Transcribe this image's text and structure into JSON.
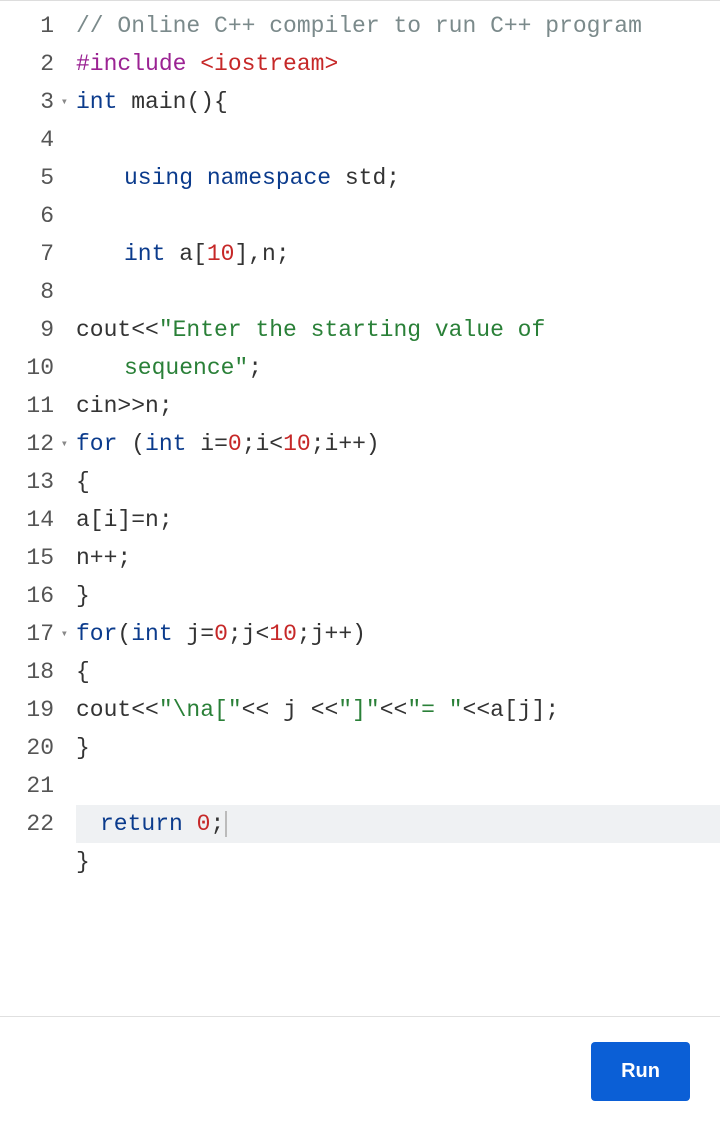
{
  "run_label": "Run",
  "lines": [
    {
      "num": "1",
      "fold": false,
      "active": false,
      "tokens": [
        {
          "cls": "comment",
          "t": "// Online C++ compiler to run C++ program"
        }
      ]
    },
    {
      "num": "2",
      "fold": false,
      "active": false,
      "tokens": [
        {
          "cls": "keyword",
          "t": "#include"
        },
        {
          "cls": "op",
          "t": " "
        },
        {
          "cls": "stringred",
          "t": "<iostream>"
        }
      ]
    },
    {
      "num": "3",
      "fold": true,
      "active": false,
      "tokens": [
        {
          "cls": "type",
          "t": "int"
        },
        {
          "cls": "op",
          "t": " "
        },
        {
          "cls": "ident",
          "t": "main(){"
        }
      ]
    },
    {
      "num": "4",
      "fold": false,
      "active": false,
      "tokens": []
    },
    {
      "num": "5",
      "fold": false,
      "active": false,
      "indent": "indent1",
      "tokens": [
        {
          "cls": "kw-blue",
          "t": "using"
        },
        {
          "cls": "op",
          "t": " "
        },
        {
          "cls": "kw-blue",
          "t": "namespace"
        },
        {
          "cls": "op",
          "t": " "
        },
        {
          "cls": "ident",
          "t": "std;"
        }
      ]
    },
    {
      "num": "6",
      "fold": false,
      "active": false,
      "tokens": []
    },
    {
      "num": "7",
      "fold": false,
      "active": false,
      "indent": "indent1",
      "tokens": [
        {
          "cls": "type",
          "t": "int"
        },
        {
          "cls": "op",
          "t": " "
        },
        {
          "cls": "ident",
          "t": "a["
        },
        {
          "cls": "number",
          "t": "10"
        },
        {
          "cls": "ident",
          "t": "],n;"
        }
      ]
    },
    {
      "num": "8",
      "fold": false,
      "active": false,
      "tokens": []
    },
    {
      "num": "9",
      "fold": false,
      "active": false,
      "tokens": [
        {
          "cls": "ident",
          "t": "cout"
        },
        {
          "cls": "op",
          "t": "<<"
        },
        {
          "cls": "string",
          "t": "\"Enter the starting value of "
        }
      ]
    },
    {
      "num": "",
      "fold": false,
      "active": false,
      "indent": "indent1",
      "tokens": [
        {
          "cls": "string",
          "t": "sequence\""
        },
        {
          "cls": "ident",
          "t": ";"
        }
      ]
    },
    {
      "num": "10",
      "fold": false,
      "active": false,
      "tokens": [
        {
          "cls": "ident",
          "t": "cin"
        },
        {
          "cls": "op",
          "t": ">>"
        },
        {
          "cls": "ident",
          "t": "n;"
        }
      ]
    },
    {
      "num": "11",
      "fold": false,
      "active": false,
      "tokens": [
        {
          "cls": "kw-blue",
          "t": "for"
        },
        {
          "cls": "op",
          "t": " ("
        },
        {
          "cls": "type",
          "t": "int"
        },
        {
          "cls": "op",
          "t": " "
        },
        {
          "cls": "ident",
          "t": "i="
        },
        {
          "cls": "number",
          "t": "0"
        },
        {
          "cls": "ident",
          "t": ";i<"
        },
        {
          "cls": "number",
          "t": "10"
        },
        {
          "cls": "ident",
          "t": ";i++)"
        }
      ]
    },
    {
      "num": "12",
      "fold": true,
      "active": false,
      "tokens": [
        {
          "cls": "ident",
          "t": "{"
        }
      ]
    },
    {
      "num": "13",
      "fold": false,
      "active": false,
      "tokens": [
        {
          "cls": "ident",
          "t": "a[i]=n;"
        }
      ]
    },
    {
      "num": "14",
      "fold": false,
      "active": false,
      "tokens": [
        {
          "cls": "ident",
          "t": "n++;"
        }
      ]
    },
    {
      "num": "15",
      "fold": false,
      "active": false,
      "tokens": [
        {
          "cls": "ident",
          "t": "}"
        }
      ]
    },
    {
      "num": "16",
      "fold": false,
      "active": false,
      "tokens": [
        {
          "cls": "kw-blue",
          "t": "for"
        },
        {
          "cls": "op",
          "t": "("
        },
        {
          "cls": "type",
          "t": "int"
        },
        {
          "cls": "op",
          "t": " "
        },
        {
          "cls": "ident",
          "t": "j="
        },
        {
          "cls": "number",
          "t": "0"
        },
        {
          "cls": "ident",
          "t": ";j<"
        },
        {
          "cls": "number",
          "t": "10"
        },
        {
          "cls": "ident",
          "t": ";j++)"
        }
      ]
    },
    {
      "num": "17",
      "fold": true,
      "active": false,
      "tokens": [
        {
          "cls": "ident",
          "t": "{"
        }
      ]
    },
    {
      "num": "18",
      "fold": false,
      "active": false,
      "tokens": [
        {
          "cls": "ident",
          "t": "cout"
        },
        {
          "cls": "op",
          "t": "<<"
        },
        {
          "cls": "string",
          "t": "\"\\na[\""
        },
        {
          "cls": "op",
          "t": "<< "
        },
        {
          "cls": "ident",
          "t": "j "
        },
        {
          "cls": "op",
          "t": "<<"
        },
        {
          "cls": "string",
          "t": "\"]\""
        },
        {
          "cls": "op",
          "t": "<<"
        },
        {
          "cls": "string",
          "t": "\"= \""
        },
        {
          "cls": "op",
          "t": "<<"
        },
        {
          "cls": "ident",
          "t": "a[j];"
        }
      ]
    },
    {
      "num": "19",
      "fold": false,
      "active": false,
      "tokens": [
        {
          "cls": "ident",
          "t": "}"
        }
      ]
    },
    {
      "num": "20",
      "fold": false,
      "active": false,
      "tokens": []
    },
    {
      "num": "21",
      "fold": false,
      "active": true,
      "indent": "indent2",
      "tokens": [
        {
          "cls": "kw-blue",
          "t": "return"
        },
        {
          "cls": "op",
          "t": " "
        },
        {
          "cls": "number",
          "t": "0"
        },
        {
          "cls": "ident",
          "t": ";"
        }
      ]
    },
    {
      "num": "22",
      "fold": false,
      "active": false,
      "tokens": [
        {
          "cls": "ident",
          "t": "}"
        }
      ]
    }
  ]
}
